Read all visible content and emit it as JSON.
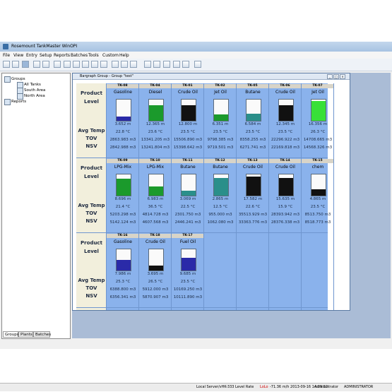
{
  "window": {
    "title": "Rosemount TankMaster WinOPI"
  },
  "menu": [
    "File",
    "View",
    "Entry",
    "Setup",
    "Reports",
    "Batches",
    "Tools",
    "Custom",
    "Help"
  ],
  "tree": {
    "groups": "Groups",
    "all_tanks": "All Tanks",
    "south_area": "South Area",
    "north_area": "North Area",
    "reports": "Reports"
  },
  "bottom_tabs": [
    "Groups",
    "Plants",
    "Batches"
  ],
  "child_window": {
    "title": "Bargraph Group - Group \"test\""
  },
  "row_labels": {
    "product": "Product",
    "level": "Level",
    "avg_temp": "Avg Temp",
    "tov": "TOV",
    "nsv": "NSV"
  },
  "colors": {
    "blue": "#2a2aa8",
    "green": "#1b9a2c",
    "black": "#111111",
    "teal": "#2a8f8a",
    "bright_green": "#38e038",
    "accent": "#8ab2ec"
  },
  "tanks": [
    [
      {
        "id": "TK-08",
        "product": "Gasoline",
        "level": "3.652 m",
        "temp": "22.8 °C",
        "tov": "2863.983 m3",
        "nsv": "2842.988 m3",
        "fill": 0.2,
        "color": "blue"
      },
      {
        "id": "TK-04",
        "product": "Diesel",
        "level": "12.365 m",
        "temp": "23.6 °C",
        "tov": "13341.205 m3",
        "nsv": "13241.804 m3",
        "fill": 0.75,
        "color": "green"
      },
      {
        "id": "TK-01",
        "product": "Crude Oil",
        "level": "12.800 m",
        "temp": "23.5 °C",
        "tov": "15506.890 m3",
        "nsv": "15398.642 m3",
        "fill": 0.75,
        "color": "black"
      },
      {
        "id": "TK-02",
        "product": "Jet Oil",
        "level": "6.351 m",
        "temp": "23.5 °C",
        "tov": "9798.385 m3",
        "nsv": "9719.501 m3",
        "fill": 0.3,
        "color": "green"
      },
      {
        "id": "TK-05",
        "product": "Butane",
        "level": "6.584 m",
        "temp": "23.5 °C",
        "tov": "8358.255 m3",
        "nsv": "6271.741 m3",
        "fill": 0.35,
        "color": "teal"
      },
      {
        "id": "TK-06",
        "product": "Crude Oil",
        "level": "12.345 m",
        "temp": "23.5 °C",
        "tov": "22296.922 m3",
        "nsv": "22169.818 m3",
        "fill": 0.75,
        "color": "black"
      },
      {
        "id": "TK-07",
        "product": "Jet Oil",
        "level": "16.356 m",
        "temp": "26.3 °C",
        "tov": "14708.665 m3",
        "nsv": "14568.326 m3",
        "fill": 0.95,
        "color": "bright_green"
      }
    ],
    [
      {
        "id": "TK-09",
        "product": "LPG-Mix",
        "level": "8.696 m",
        "temp": "21.4 °C",
        "tov": "5203.298 m3",
        "nsv": "5142.124 m3",
        "fill": 0.8,
        "color": "green"
      },
      {
        "id": "TK-10",
        "product": "LPG-Mix",
        "level": "6.983 m",
        "temp": "36.5 °C",
        "tov": "4814.728 m3",
        "nsv": "4607.568 m3",
        "fill": 0.45,
        "color": "green"
      },
      {
        "id": "TK-11",
        "product": "Butane",
        "level": "3.069 m",
        "temp": "22.5 °C",
        "tov": "2301.750 m3",
        "nsv": "2446.241 m3",
        "fill": 0.25,
        "color": "teal"
      },
      {
        "id": "TK-12",
        "product": "Butane",
        "level": "2.865 m",
        "temp": "12.5 °C",
        "tov": "955.000 m3",
        "nsv": "1062.080 m3",
        "fill": 0.85,
        "color": "teal"
      },
      {
        "id": "TK-13",
        "product": "Crude Oil",
        "level": "17.582 m",
        "temp": "22.6 °C",
        "tov": "35513.929 m3",
        "nsv": "33363.776 m3",
        "fill": 0.9,
        "color": "black"
      },
      {
        "id": "TK-14",
        "product": "Crude Oil",
        "level": "15.635 m",
        "temp": "15.9 °C",
        "tov": "28393.942 m3",
        "nsv": "28376.338 m3",
        "fill": 0.85,
        "color": "black"
      },
      {
        "id": "TK-15",
        "product": "chem",
        "level": "4.865 m",
        "temp": "23.5 °C",
        "tov": "8513.750 m3",
        "nsv": "8518.773 m3",
        "fill": 0.3,
        "color": "black"
      }
    ],
    [
      {
        "id": "TK-16",
        "product": "Gasoline",
        "level": "7.986 m",
        "temp": "25.3 °C",
        "tov": "6388.800 m3",
        "nsv": "6356.341 m3",
        "fill": 0.5,
        "color": "blue"
      },
      {
        "id": "TK-18",
        "product": "Crude Oil",
        "level": "3.695 m",
        "temp": "26.5 °C",
        "tov": "5912.000 m3",
        "nsv": "5870.907 m3",
        "fill": 0.25,
        "color": "black"
      },
      {
        "id": "TK-17",
        "product": "Fuel Oil",
        "level": "9.685 m",
        "temp": "23.5 °C",
        "tov": "10169.250 m3",
        "nsv": "10111.890 m3",
        "fill": 0.6,
        "color": "blue"
      }
    ]
  ],
  "status": {
    "server": "Local Server/vHK-333 Level Rate",
    "alarm": "LoLo",
    "reading": "-71.36 m/h 2013-09-16 14:09:12",
    "user": "Administrator",
    "role": "ADMINISTRATOR"
  }
}
